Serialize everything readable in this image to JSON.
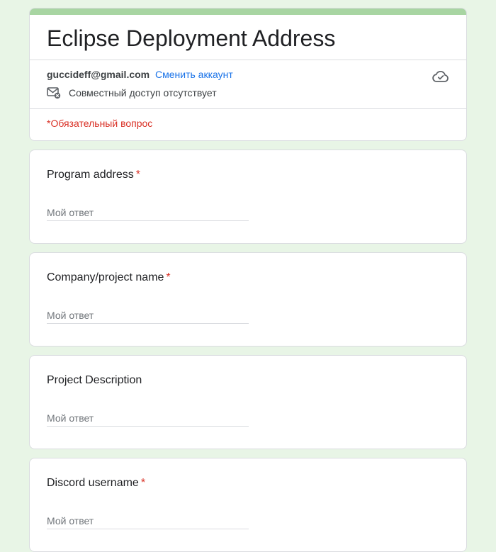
{
  "form": {
    "title": "Eclipse Deployment Address",
    "accent_color": "#a8d5a2",
    "background_color": "#e8f5e6"
  },
  "account": {
    "email": "guccideff@gmail.com",
    "switch_label": "Сменить аккаунт",
    "share_status": "Совместный доступ отсутствует",
    "share_icon": "mail-not-shared-icon",
    "save_icon": "cloud-check-icon"
  },
  "required_note": "*Обязательный вопрос",
  "questions": [
    {
      "title": "Program address",
      "required_mark": "*",
      "placeholder": "Мой ответ"
    },
    {
      "title": "Company/project name",
      "required_mark": "*",
      "placeholder": "Мой ответ"
    },
    {
      "title": "Project Description",
      "required_mark": "",
      "placeholder": "Мой ответ"
    },
    {
      "title": "Discord username",
      "required_mark": "*",
      "placeholder": "Мой ответ"
    }
  ]
}
